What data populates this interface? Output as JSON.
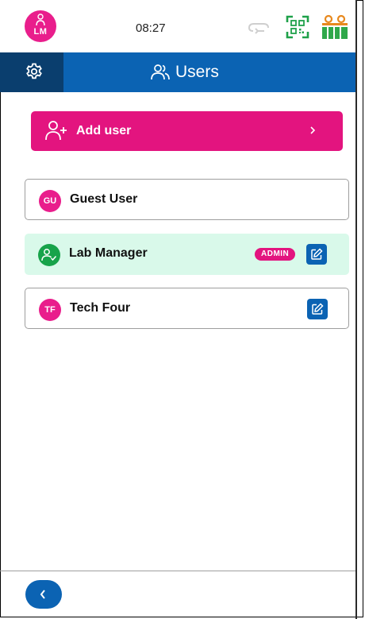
{
  "status_bar": {
    "avatar_initials": "LM",
    "time": "08:27",
    "icons": [
      "sync-icon",
      "qr-scanner-icon",
      "battery-icon"
    ]
  },
  "header": {
    "settings_icon": "gear-icon",
    "title": "Users",
    "title_icon": "users-icon"
  },
  "add_user": {
    "label": "Add user"
  },
  "users": [
    {
      "initials": "GU",
      "name": "Guest User",
      "badge": "",
      "editable": false,
      "active": false
    },
    {
      "initials": "",
      "name": "Lab Manager",
      "badge": "ADMIN",
      "editable": true,
      "active": true
    },
    {
      "initials": "TF",
      "name": "Tech Four",
      "badge": "",
      "editable": true,
      "active": false
    }
  ],
  "colors": {
    "primary_blue": "#0b63b3",
    "dark_blue": "#0a3e6e",
    "magenta": "#e3147f",
    "green": "#17a34a",
    "active_row_bg": "#d9f9ea"
  }
}
